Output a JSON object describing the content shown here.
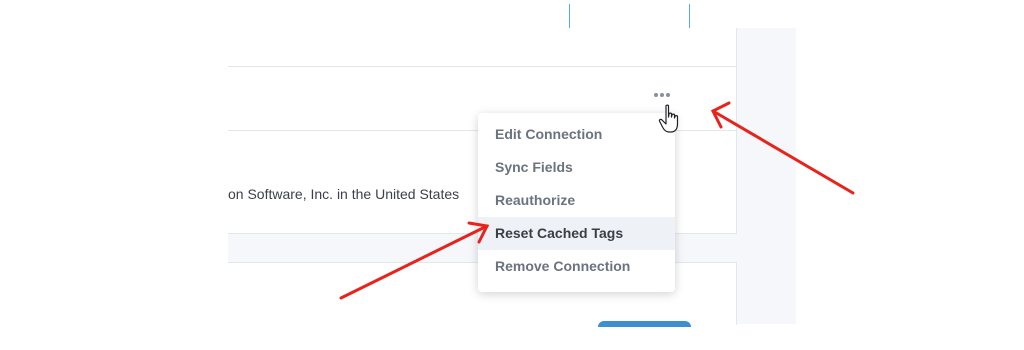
{
  "footer": {
    "text": "on Software, Inc. in the United States"
  },
  "menu": {
    "items": [
      {
        "label": "Edit Connection"
      },
      {
        "label": "Sync Fields"
      },
      {
        "label": "Reauthorize"
      },
      {
        "label": "Reset Cached Tags"
      },
      {
        "label": "Remove Connection"
      }
    ],
    "active_index": 3
  },
  "icons": {
    "more": "ellipsis-horizontal",
    "cursor": "hand-pointer"
  },
  "colors": {
    "annotation_arrow": "#e8231b",
    "button_border": "#5aa7dc",
    "button_fill": "#3d8fd1"
  }
}
